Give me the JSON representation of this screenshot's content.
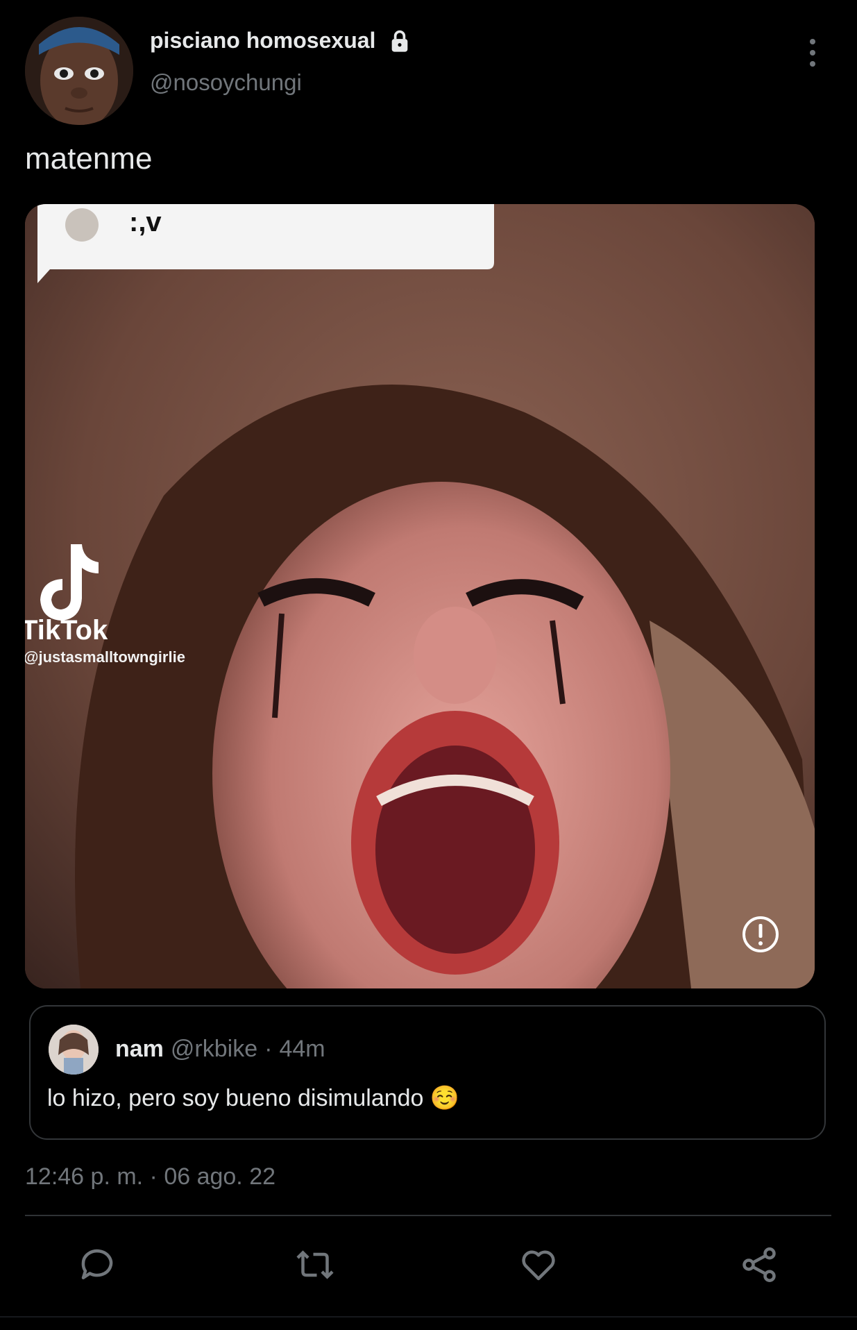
{
  "author": {
    "display_name": "pisciano homosexual",
    "handle": "@nosoychungi",
    "avatar_icon": "avatar-photo",
    "protected_icon": "lock-icon"
  },
  "tweet": {
    "text": "matenme",
    "timestamp": "12:46 p. m. · 06 ago. 22"
  },
  "media": {
    "caption_bubble": ":,v",
    "watermark_brand": "TikTok",
    "watermark_handle": "@justasmalltowngirlie",
    "alert_icon": "sensitive-info-icon"
  },
  "quoted_tweet": {
    "name": "nam",
    "handle": "@rkbike",
    "separator": "·",
    "time": "44m",
    "text": "lo hizo, pero soy bueno disimulando ☺️"
  },
  "actions": {
    "icons": [
      "reply-icon",
      "retweet-icon",
      "like-icon",
      "share-icon"
    ]
  },
  "colors": {
    "background": "#000000",
    "primary_text": "#e7e9ea",
    "secondary_text": "#71767b",
    "border": "#333639"
  }
}
